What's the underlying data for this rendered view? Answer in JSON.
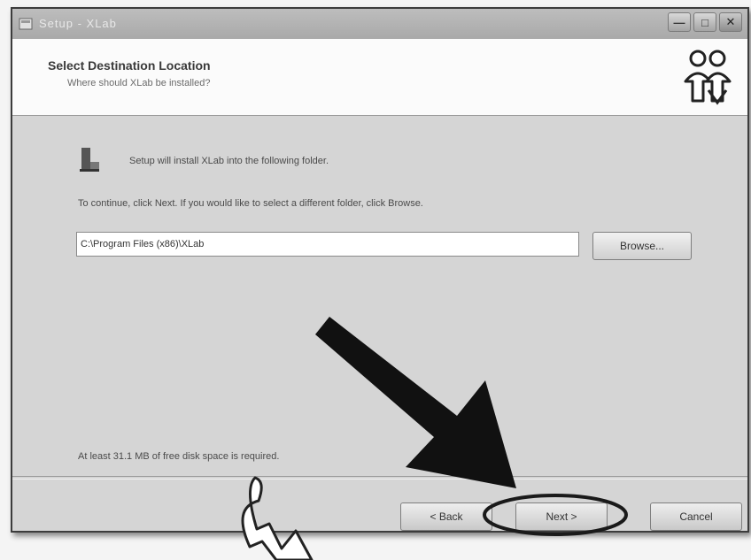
{
  "window": {
    "title": "Setup - XLab",
    "controls": {
      "minimize": "—",
      "maximize": "□",
      "close": "✕"
    },
    "app_icon": "installer-icon"
  },
  "header": {
    "title": "Select Destination Location",
    "subtitle": "Where should XLab be installed?",
    "logo_icon": "setup-people-logo"
  },
  "body": {
    "folder_icon": "folder-icon",
    "info_text": "Setup will install XLab into the following folder.",
    "instruction_text": "To continue, click Next. If you would like to select a different folder, click Browse.",
    "path_value": "C:\\Program Files (x86)\\XLab",
    "browse_label": "Browse...",
    "space_text": "At least 31.1 MB of free disk space is required."
  },
  "footer": {
    "back_label": "< Back",
    "next_label": "Next >",
    "cancel_label": "Cancel"
  },
  "annotations": {
    "arrow_color": "#111111",
    "circle_color": "#1a1a1a",
    "callout_arrow": "white-curved-arrow"
  }
}
